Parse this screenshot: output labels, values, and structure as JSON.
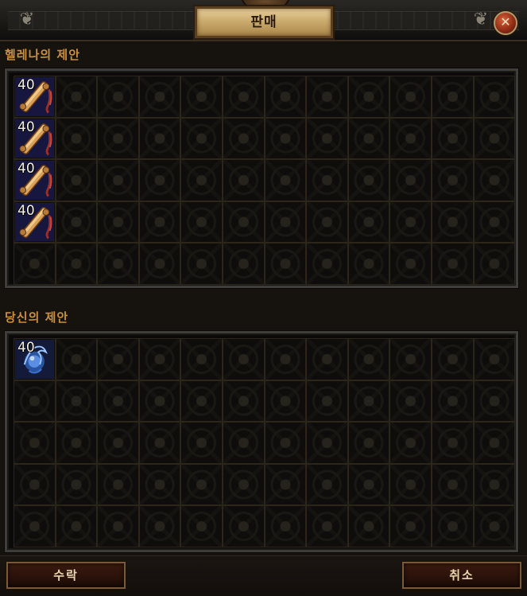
{
  "window": {
    "title": "판매",
    "close_glyph": "✕",
    "close_icon": "close-icon",
    "flourish_glyph": "❦"
  },
  "helena_offer": {
    "label": "헬레나의 제안",
    "columns": 12,
    "rows": 5,
    "items": [
      {
        "name": "scroll",
        "icon": "scroll-icon",
        "count": "40",
        "col": 0,
        "row": 0
      },
      {
        "name": "scroll",
        "icon": "scroll-icon",
        "count": "40",
        "col": 0,
        "row": 1
      },
      {
        "name": "scroll",
        "icon": "scroll-icon",
        "count": "40",
        "col": 0,
        "row": 2
      },
      {
        "name": "scroll",
        "icon": "scroll-icon",
        "count": "40",
        "col": 0,
        "row": 3
      }
    ]
  },
  "your_offer": {
    "label": "당신의 제안",
    "columns": 12,
    "rows": 5,
    "items": [
      {
        "name": "orb",
        "icon": "orb-icon",
        "count": "40",
        "col": 0,
        "row": 0
      }
    ]
  },
  "buttons": {
    "accept": "수락",
    "cancel": "취소"
  },
  "colors": {
    "section_label": "#c98f3e",
    "title_plate": "#c9a86a",
    "close_button": "#8c2a14",
    "scroll_item_bg": "#16163e",
    "orb_item_bg": "#141a3a"
  }
}
